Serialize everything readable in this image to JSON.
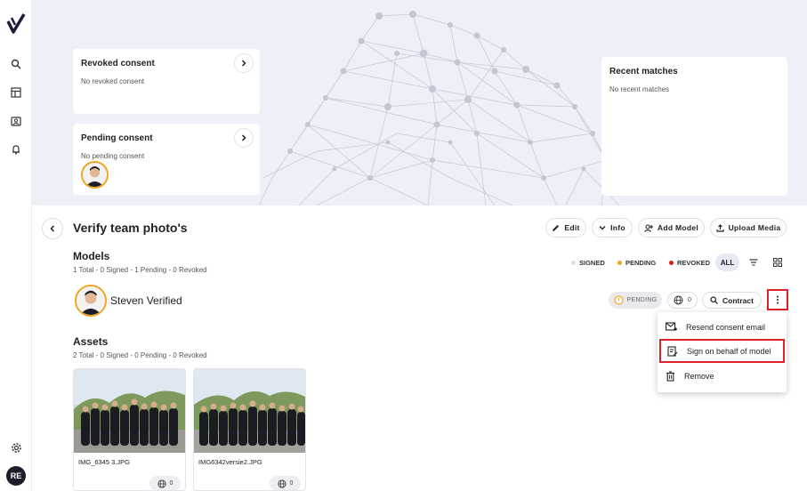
{
  "hero": {
    "revoked": {
      "title": "Revoked consent",
      "empty": "No revoked consent"
    },
    "pending": {
      "title": "Pending consent",
      "empty": "No pending consent"
    },
    "recent": {
      "title": "Recent matches",
      "empty": "No recent matches"
    }
  },
  "header": {
    "title": "Verify team photo's",
    "actions": {
      "edit": "Edit",
      "info": "Info",
      "add_model": "Add Model",
      "upload": "Upload Media"
    }
  },
  "models": {
    "title": "Models",
    "summary": "1 Total - 0 Signed - 1 Pending - 0 Revoked",
    "filters": {
      "signed": "SIGNED",
      "pending": "PENDING",
      "revoked": "REVOKED",
      "all": "ALL"
    },
    "row": {
      "name": "Steven Verified",
      "status": "PENDING",
      "globe_count": "0",
      "contract": "Contract"
    }
  },
  "menu": {
    "resend": "Resend consent email",
    "sign": "Sign on behalf of model",
    "remove": "Remove"
  },
  "assets": {
    "title": "Assets",
    "summary": "2 Total - 0 Signed - 0 Pending - 0 Revoked",
    "items": [
      {
        "name": "IMG_6345 3.JPG",
        "count": "0"
      },
      {
        "name": "IMG6342versie2.JPG",
        "count": "0"
      }
    ]
  },
  "user": {
    "initials": "RE"
  },
  "colors": {
    "accent_red": "#e0202a",
    "pending_dot": "#f0a51e",
    "revoked_dot": "#d21e1e",
    "signed_dot": "#dddddd",
    "hero_bg": "#eef0f7"
  }
}
